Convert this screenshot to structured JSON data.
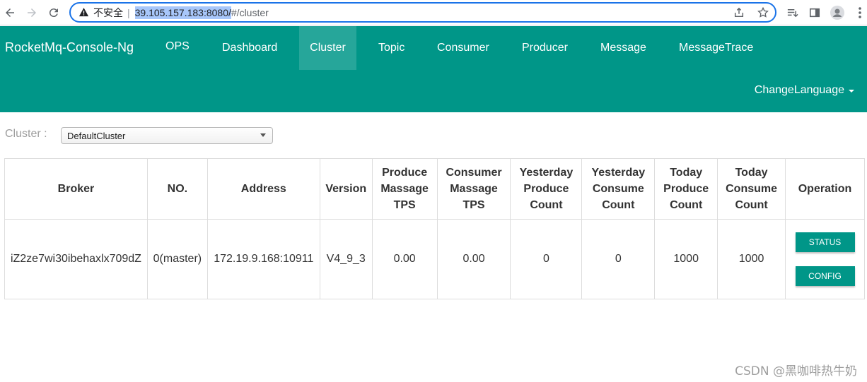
{
  "browser": {
    "insecure_label": "不安全",
    "separator": "|",
    "url_host": "39.105.157.183:8080/",
    "url_rest": "#/cluster"
  },
  "header": {
    "brand": "RocketMq-Console-Ng",
    "nav": [
      {
        "label": "OPS"
      },
      {
        "label": "Dashboard"
      },
      {
        "label": "Cluster"
      },
      {
        "label": "Topic"
      },
      {
        "label": "Consumer"
      },
      {
        "label": "Producer"
      },
      {
        "label": "Message"
      },
      {
        "label": "MessageTrace"
      }
    ],
    "active_nav": "Cluster",
    "change_language": "ChangeLanguage"
  },
  "cluster": {
    "label": "Cluster :",
    "selected": "DefaultCluster"
  },
  "table": {
    "headers": [
      "Broker",
      "NO.",
      "Address",
      "Version",
      "Produce Massage TPS",
      "Consumer Massage TPS",
      "Yesterday Produce Count",
      "Yesterday Consume Count",
      "Today Produce Count",
      "Today Consume Count",
      "Operation"
    ],
    "rows": [
      {
        "broker": "iZ2ze7wi30ibehaxlx709dZ",
        "no": "0(master)",
        "address": "172.19.9.168:10911",
        "version": "V4_9_3",
        "produce_tps": "0.00",
        "consumer_tps": "0.00",
        "yesterday_produce": "0",
        "yesterday_consume": "0",
        "today_produce": "1000",
        "today_consume": "1000",
        "status_button": "STATUS",
        "config_button": "CONFIG"
      }
    ]
  },
  "watermark": "CSDN @黑咖啡热牛奶",
  "colors": {
    "header_bg": "#009688",
    "active_nav_bg": "#26a69a",
    "button_bg": "#009688"
  }
}
